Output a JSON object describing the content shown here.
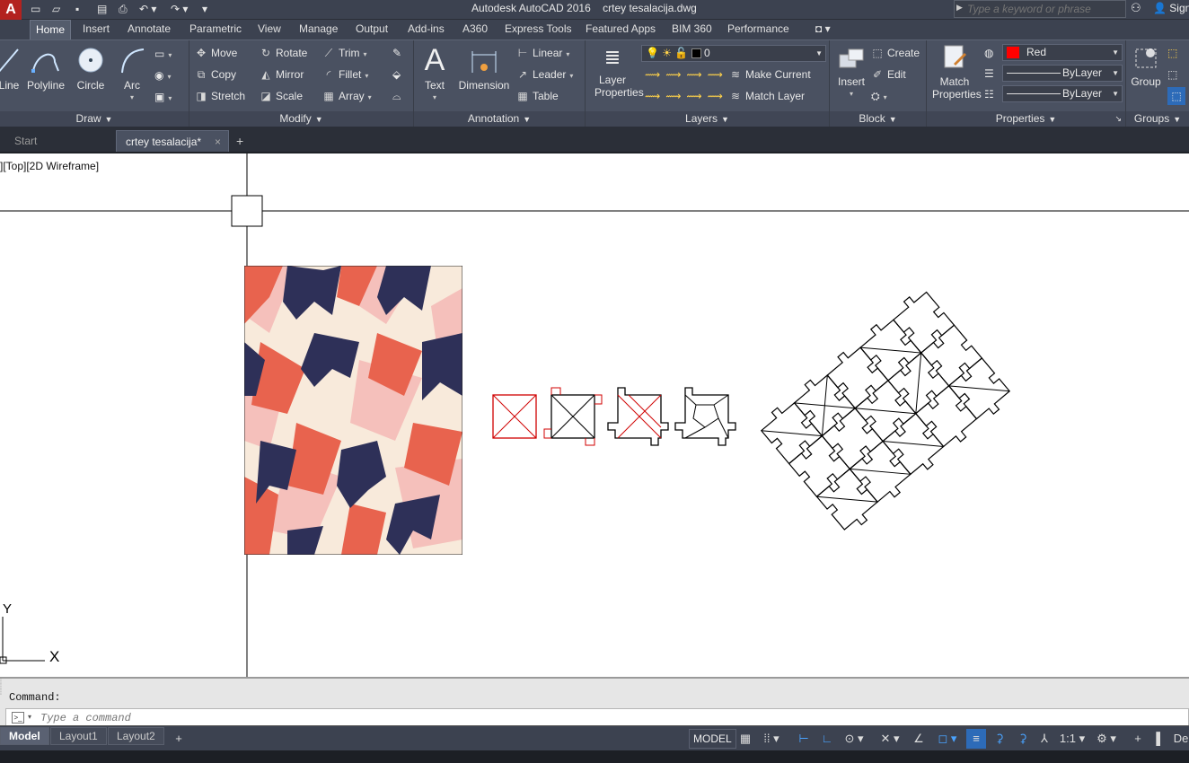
{
  "app": {
    "title": "Autodesk AutoCAD 2016",
    "filename": "crtey tesalacija.dwg",
    "logo": "A",
    "search_placeholder": "Type a keyword or phrase",
    "sign_in": "Sign In"
  },
  "ribbon_tabs": [
    "Home",
    "Insert",
    "Annotate",
    "Parametric",
    "View",
    "Manage",
    "Output",
    "Add-ins",
    "A360",
    "Express Tools",
    "Featured Apps",
    "BIM 360",
    "Performance"
  ],
  "draw": {
    "title": "Draw",
    "line": "Line",
    "polyline": "Polyline",
    "circle": "Circle",
    "arc": "Arc"
  },
  "modify": {
    "title": "Modify",
    "move": "Move",
    "rotate": "Rotate",
    "trim": "Trim",
    "copy": "Copy",
    "mirror": "Mirror",
    "fillet": "Fillet",
    "stretch": "Stretch",
    "scale": "Scale",
    "array": "Array"
  },
  "annotation": {
    "title": "Annotation",
    "text": "Text",
    "dimension": "Dimension",
    "linear": "Linear",
    "leader": "Leader",
    "table": "Table"
  },
  "layers": {
    "title": "Layers",
    "layer_properties_1": "Layer",
    "layer_properties_2": "Properties",
    "current_layer": "0",
    "make_current": "Make Current",
    "match_layer": "Match Layer"
  },
  "block": {
    "title": "Block",
    "insert": "Insert",
    "create": "Create",
    "edit": "Edit"
  },
  "properties": {
    "title": "Properties",
    "match_1": "Match",
    "match_2": "Properties",
    "color": "Red",
    "color_hex": "#ff0000",
    "linetype": "ByLayer",
    "lineweight": "ByLayer"
  },
  "groups": {
    "title": "Groups",
    "group": "Group"
  },
  "doc_tabs": {
    "start": "Start",
    "active": "crtey tesalacija*",
    "close": "×",
    "add": "+"
  },
  "viewport": {
    "label": "][Top][2D Wireframe]",
    "ucs_x": "X",
    "ucs_y": "Y"
  },
  "command": {
    "history": "Command:",
    "placeholder": "Type a command"
  },
  "layouts": [
    "Model",
    "Layout1",
    "Layout2"
  ],
  "status": {
    "model": "MODEL",
    "scale": "1:1",
    "right": "De"
  },
  "colors": {
    "pattern_navy": "#2e3058",
    "pattern_coral": "#e8634e",
    "pattern_pink": "#f5c0bb",
    "pattern_cream": "#f8eadb",
    "ribbon_bg": "#4a5161",
    "accent_blue": "#2d8ce6"
  }
}
